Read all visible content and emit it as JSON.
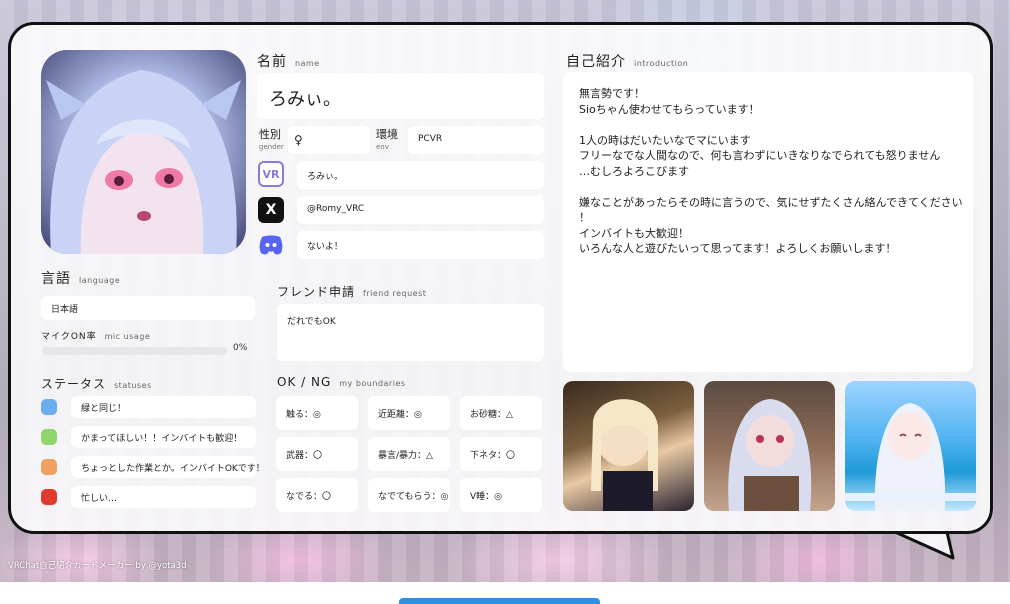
{
  "footer": {
    "credit": "VRChat自己紹介カードメーカー by @yota3d"
  },
  "card": {
    "name": {
      "heading": "名前",
      "heading_sub": "name",
      "value": "ろみぃ。"
    },
    "gender": {
      "label": "性別",
      "sub": "gender",
      "value": "♀"
    },
    "env": {
      "label": "環境",
      "sub": "env",
      "value": "PCVR"
    },
    "accounts": [
      {
        "icon": "vrchat-icon",
        "icon_text": "VR",
        "value": "ろみぃ。"
      },
      {
        "icon": "x-twitter-icon",
        "icon_text": "X",
        "value": "@Romy_VRC"
      },
      {
        "icon": "discord-icon",
        "icon_text": "",
        "value": "ないよ！"
      }
    ],
    "language": {
      "heading": "言語",
      "heading_sub": "language",
      "value": "日本語"
    },
    "mic": {
      "heading": "マイクON率",
      "heading_sub": "mic usage",
      "value_label": "0%",
      "value": 0
    },
    "statuses": {
      "heading": "ステータス",
      "heading_sub": "statuses",
      "items": [
        {
          "color": "#6aaef0",
          "text": "緑と同じ！"
        },
        {
          "color": "#8ed66a",
          "text": "かまってほしい！！インバイトも歓迎！"
        },
        {
          "color": "#f0a060",
          "text": "ちょっとした作業とか。インバイトOKです！"
        },
        {
          "color": "#e03b2f",
          "text": "忙しい…"
        }
      ]
    },
    "friend_request": {
      "heading": "フレンド申請",
      "heading_sub": "friend request",
      "value": "だれでもOK"
    },
    "boundaries": {
      "heading": "OK / NG",
      "heading_sub": "my boundaries",
      "items": [
        "触る：◎",
        "近距離：◎",
        "お砂糖：△",
        "武器：〇",
        "暴言/暴力：△",
        "下ネタ：〇",
        "なでる：〇",
        "なでてもらう：◎",
        "V睡：◎"
      ]
    },
    "intro": {
      "heading": "自己紹介",
      "heading_sub": "introduction",
      "lines": [
        "無言勢です！",
        "Sioちゃん使わせてもらっています！",
        "",
        "1人の時はだいたいなでマにいます",
        "フリーなでな人間なので、何も言わずにいきなりなでられても怒りません",
        "…むしろよろこびます",
        "",
        "嫌なことがあったらその時に言うので、気にせずたくさん絡んできてください",
        "！",
        "インバイトも大歓迎！",
        "いろんな人と遊びたいって思ってます！よろしくお願いします！"
      ]
    }
  }
}
